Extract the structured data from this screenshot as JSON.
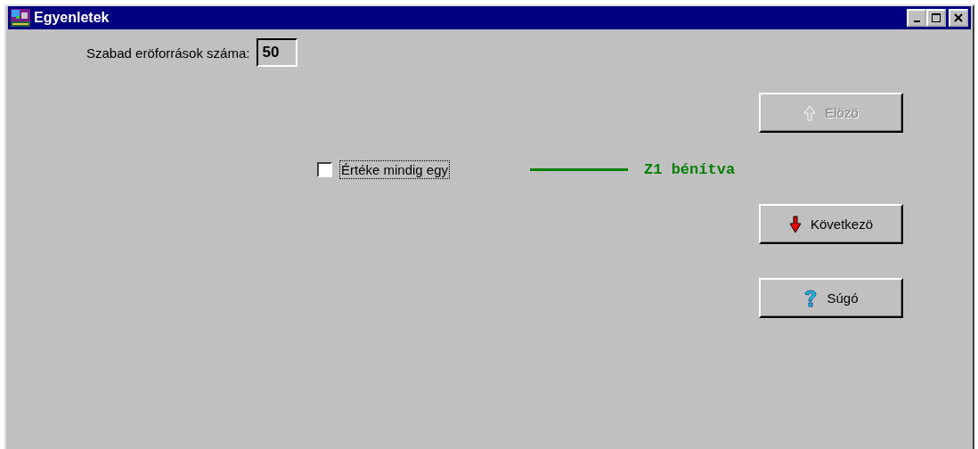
{
  "window": {
    "title": "Egyenletek"
  },
  "resources": {
    "label": "Szabad eröforrások száma:",
    "value": "50"
  },
  "checkbox": {
    "label": "Értéke mindig egy",
    "checked": false,
    "focused": true
  },
  "status": {
    "text": "Z1 bénítva"
  },
  "buttons": [
    {
      "kind": "up",
      "label": "Elözö",
      "disabled": true
    },
    {
      "kind": "down",
      "label": "Következö",
      "disabled": false
    },
    {
      "kind": "help",
      "label": "Súgó",
      "disabled": false
    }
  ]
}
